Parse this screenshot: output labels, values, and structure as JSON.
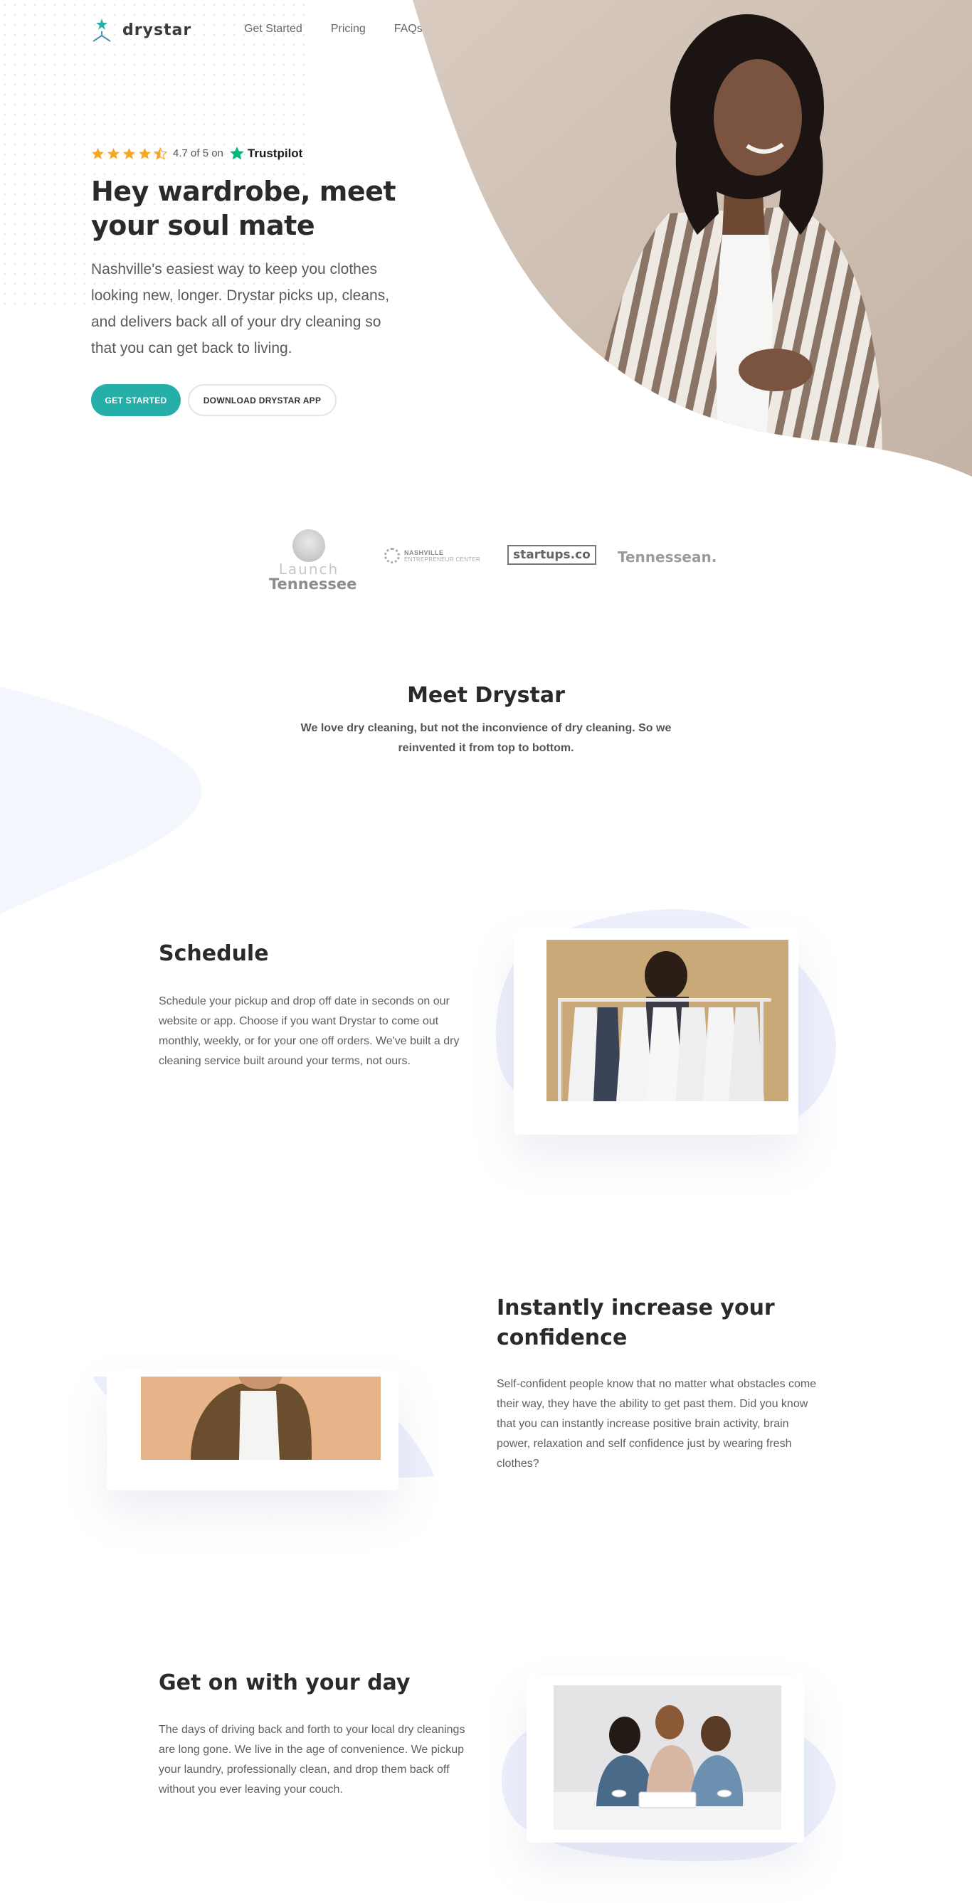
{
  "brand": {
    "name": "drystar",
    "accent": "#26afa9",
    "logo_icon": "star-hanger-icon"
  },
  "nav": {
    "items": [
      "Get Started",
      "Pricing",
      "FAQs"
    ]
  },
  "hero": {
    "rating_text": "4.7 of 5 on",
    "rating_value": 4.5,
    "trustpilot_label": "Trustpilot",
    "title": "Hey wardrobe, meet your soul mate",
    "subtitle": "Nashville's easiest way to keep you clothes looking new, longer. Drystar picks up, cleans, and delivers back all of your dry cleaning so that you can get back to living.",
    "primary_button": "GET STARTED",
    "secondary_button": "DOWNLOAD DRYSTAR APP"
  },
  "partners": {
    "launch": [
      "Launch",
      "Tennessee"
    ],
    "nashville": [
      "NASHVILLE",
      "ENTREPRENEUR CENTER"
    ],
    "startups": "startups.co",
    "tennessean": "Tennessean."
  },
  "meet": {
    "title": "Meet Drystar",
    "subtitle": "We love dry cleaning, but not the inconvience of dry cleaning. So we reinvented it from top to bottom."
  },
  "features": [
    {
      "title": "Schedule",
      "body": "Schedule your pickup and drop off date in seconds on our website or app. Choose if you want Drystar to come out monthly, weekly, or for your one off orders. We've built a dry cleaning service built around your terms, not ours."
    },
    {
      "title": "Instantly increase your confidence",
      "body": "Self-confident people know that no matter what obstacles come their way, they have the ability to get past them. Did you know that you can instantly increase positive brain activity, brain power, relaxation and self confidence just by wearing fresh clothes?"
    },
    {
      "title": "Get on with your day",
      "body": "The days of driving back and forth to your local dry cleanings are long gone. We live in the age of convenience. We pickup your laundry, professionally clean, and drop them back off without you ever leaving your couch."
    }
  ]
}
